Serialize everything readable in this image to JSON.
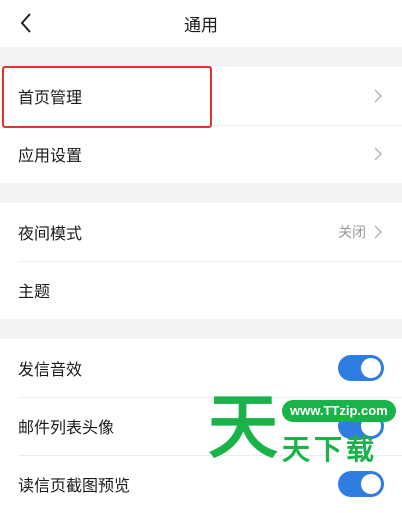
{
  "header": {
    "title": "通用"
  },
  "groups": [
    {
      "items": [
        {
          "label": "首页管理"
        },
        {
          "label": "应用设置"
        }
      ]
    },
    {
      "items": [
        {
          "label": "夜间模式",
          "value": "关闭"
        },
        {
          "label": "主题"
        }
      ]
    },
    {
      "items": [
        {
          "label": "发信音效",
          "toggle_on": true
        },
        {
          "label": "邮件列表头像",
          "toggle_on": true
        },
        {
          "label": "读信页截图预览",
          "toggle_on": true
        }
      ]
    }
  ],
  "watermark": {
    "big": "天",
    "pill": "www.TTzip.com",
    "small": "天下载"
  },
  "colors": {
    "accent": "#2f7de1",
    "highlight": "#e0322f",
    "watermark": "#19b34a"
  }
}
